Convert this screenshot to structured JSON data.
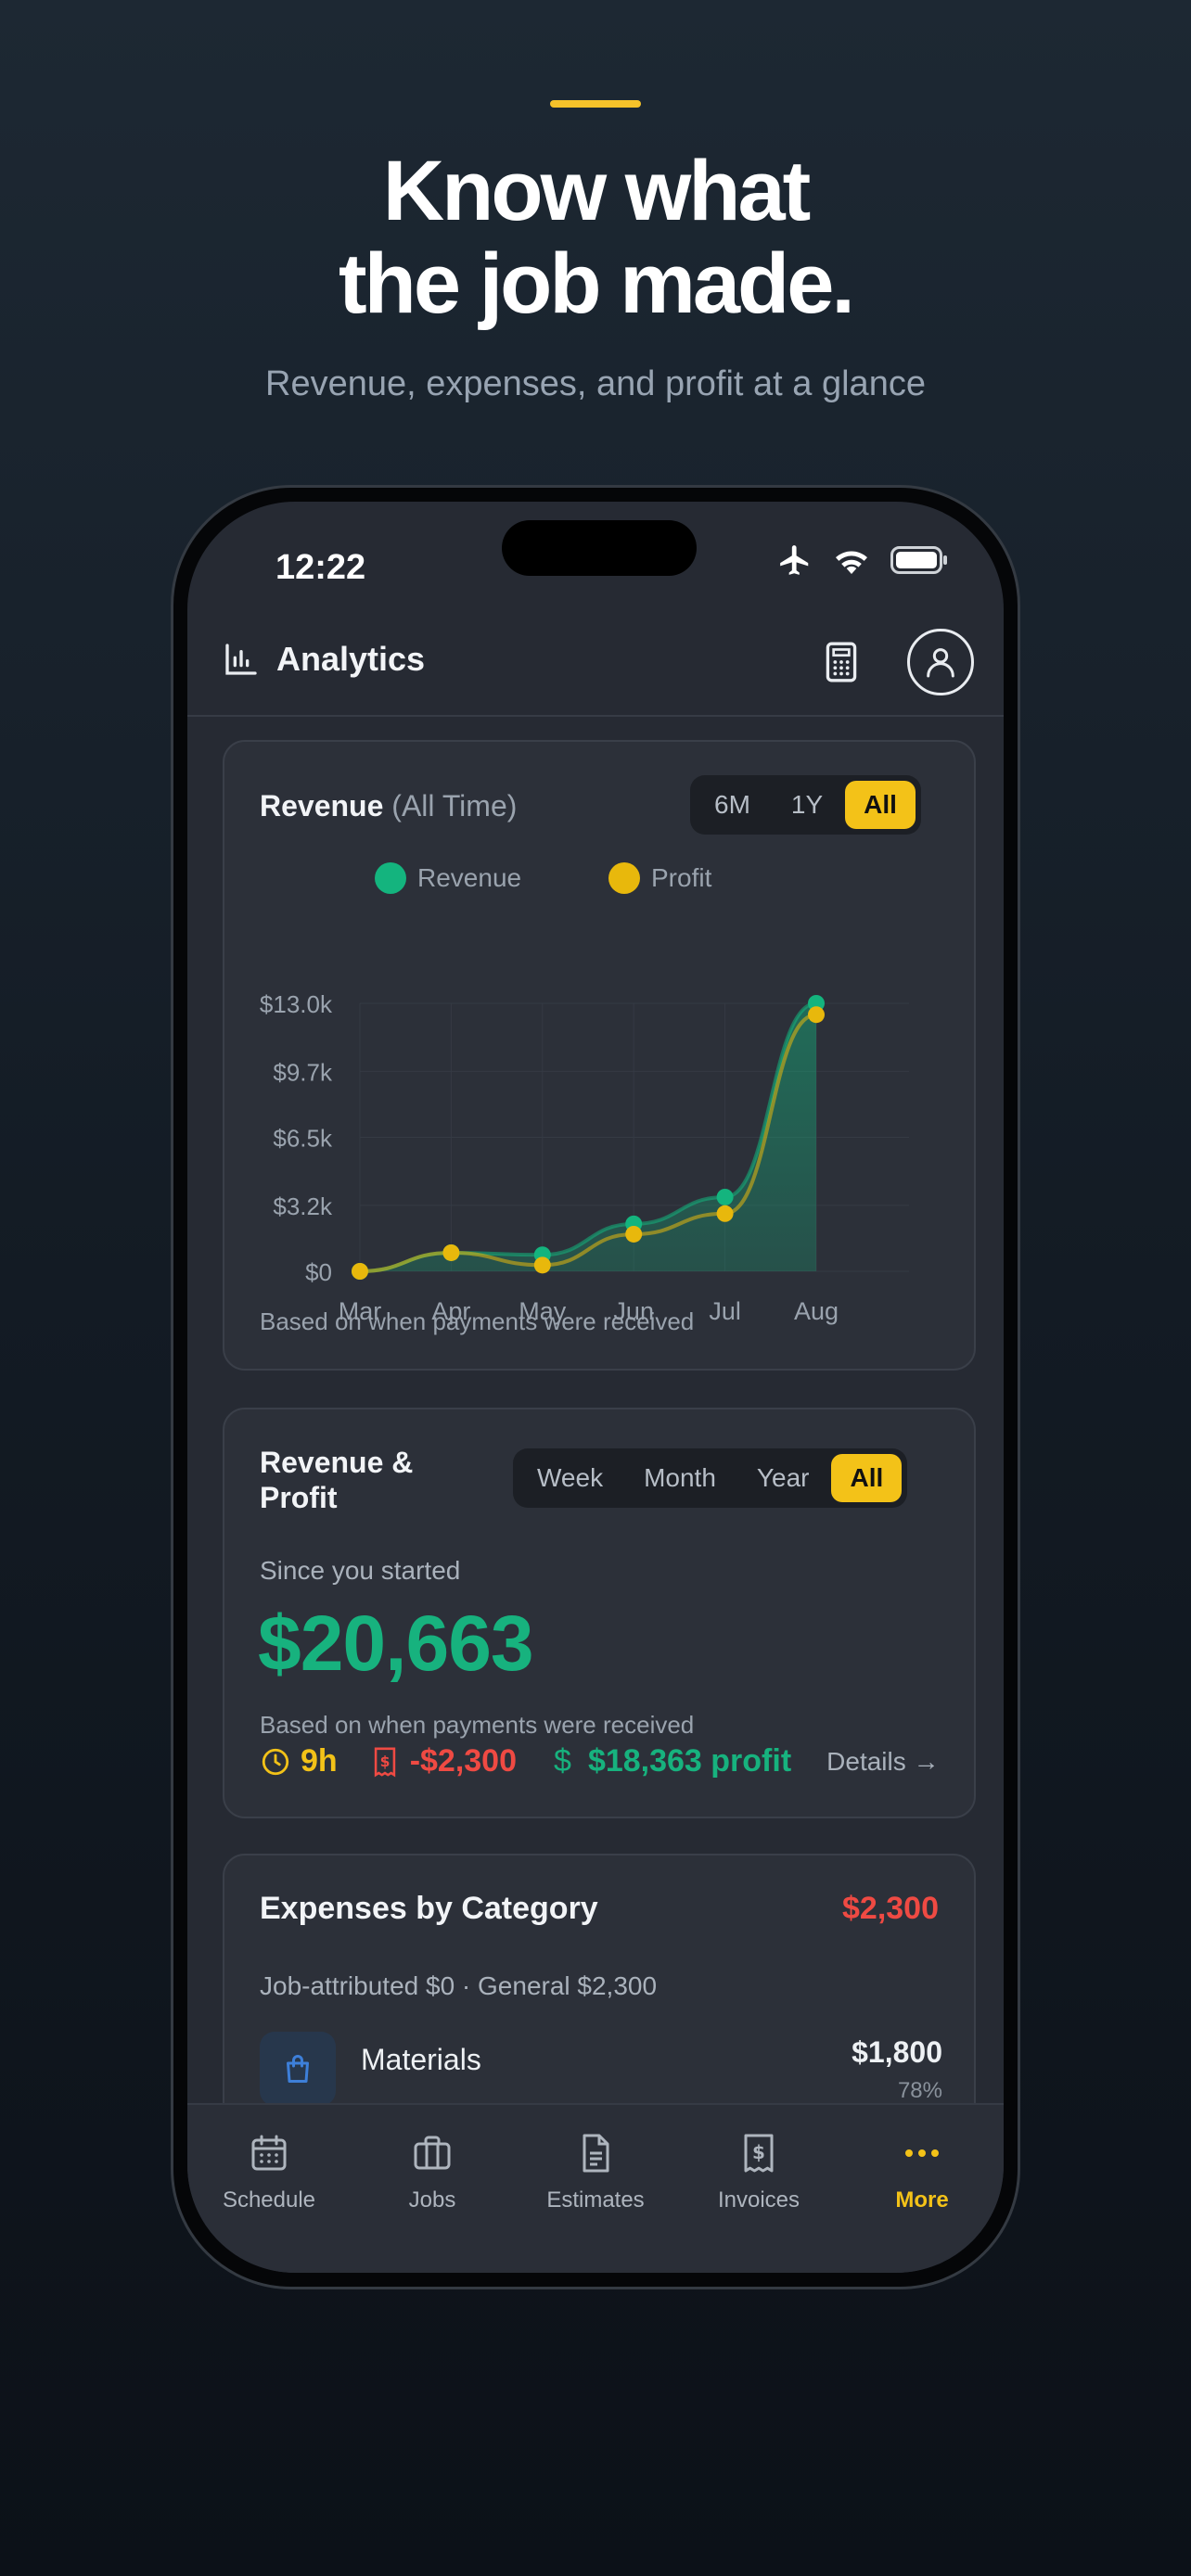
{
  "marketing": {
    "headline_line1": "Know what",
    "headline_line2": "the job made.",
    "subtitle": "Revenue, expenses, and profit at a glance",
    "accent_color": "#f5c22a"
  },
  "status_bar": {
    "time": "12:22"
  },
  "app_bar": {
    "title": "Analytics",
    "icons": [
      "bar-chart-icon",
      "calculator-icon",
      "profile-icon"
    ]
  },
  "revenue_card": {
    "title": "Revenue",
    "title_suffix": "(All Time)",
    "ranges": [
      {
        "label": "6M",
        "active": false
      },
      {
        "label": "1Y",
        "active": false
      },
      {
        "label": "All",
        "active": true
      }
    ],
    "legend": [
      {
        "label": "Revenue",
        "color": "#14b47e"
      },
      {
        "label": "Profit",
        "color": "#e8b80c"
      }
    ],
    "y_ticks": [
      "$13.0k",
      "$9.7k",
      "$6.5k",
      "$3.2k",
      "$0"
    ],
    "x_ticks": [
      "Mar",
      "Apr",
      "May",
      "Jun",
      "Jul",
      "Aug"
    ],
    "note": "Based on when payments were received"
  },
  "chart_data": {
    "type": "line",
    "categories": [
      "Mar",
      "Apr",
      "May",
      "Jun",
      "Jul",
      "Aug"
    ],
    "series": [
      {
        "name": "Revenue",
        "values": [
          0,
          900,
          800,
          2300,
          3600,
          13000
        ],
        "color": "#14b47e"
      },
      {
        "name": "Profit",
        "values": [
          0,
          900,
          300,
          1800,
          2800,
          12450
        ],
        "color": "#e8b80c"
      }
    ],
    "ylim": [
      0,
      13000
    ],
    "y_tick_values": [
      13000,
      9700,
      6500,
      3200,
      0
    ],
    "grid": true,
    "legend": "top"
  },
  "profit_card": {
    "title_line1": "Revenue &",
    "title_line2": "Profit",
    "ranges": [
      {
        "label": "Week",
        "active": false
      },
      {
        "label": "Month",
        "active": false
      },
      {
        "label": "Year",
        "active": false
      },
      {
        "label": "All",
        "active": true
      }
    ],
    "since_label": "Since you started",
    "total": "$20,663",
    "note": "Based on when payments were received",
    "hours": "9h",
    "expenses": "-$2,300",
    "profit": "$18,363 profit",
    "details_label": "Details →",
    "colors": {
      "total": "#17b27e",
      "hours": "#f3c218",
      "expenses": "#ef4a43",
      "profit": "#17b27e"
    }
  },
  "expenses_card": {
    "title": "Expenses by Category",
    "total": "$2,300",
    "subtitle": "Job-attributed $0 · General $2,300",
    "items": [
      {
        "label": "Materials",
        "amount": "$1,800",
        "percent": "78%"
      }
    ]
  },
  "tabs": [
    {
      "label": "Schedule",
      "icon": "calendar-icon",
      "active": false
    },
    {
      "label": "Jobs",
      "icon": "briefcase-icon",
      "active": false
    },
    {
      "label": "Estimates",
      "icon": "document-icon",
      "active": false
    },
    {
      "label": "Invoices",
      "icon": "receipt-icon",
      "active": false
    },
    {
      "label": "More",
      "icon": "more-icon",
      "active": true
    }
  ]
}
